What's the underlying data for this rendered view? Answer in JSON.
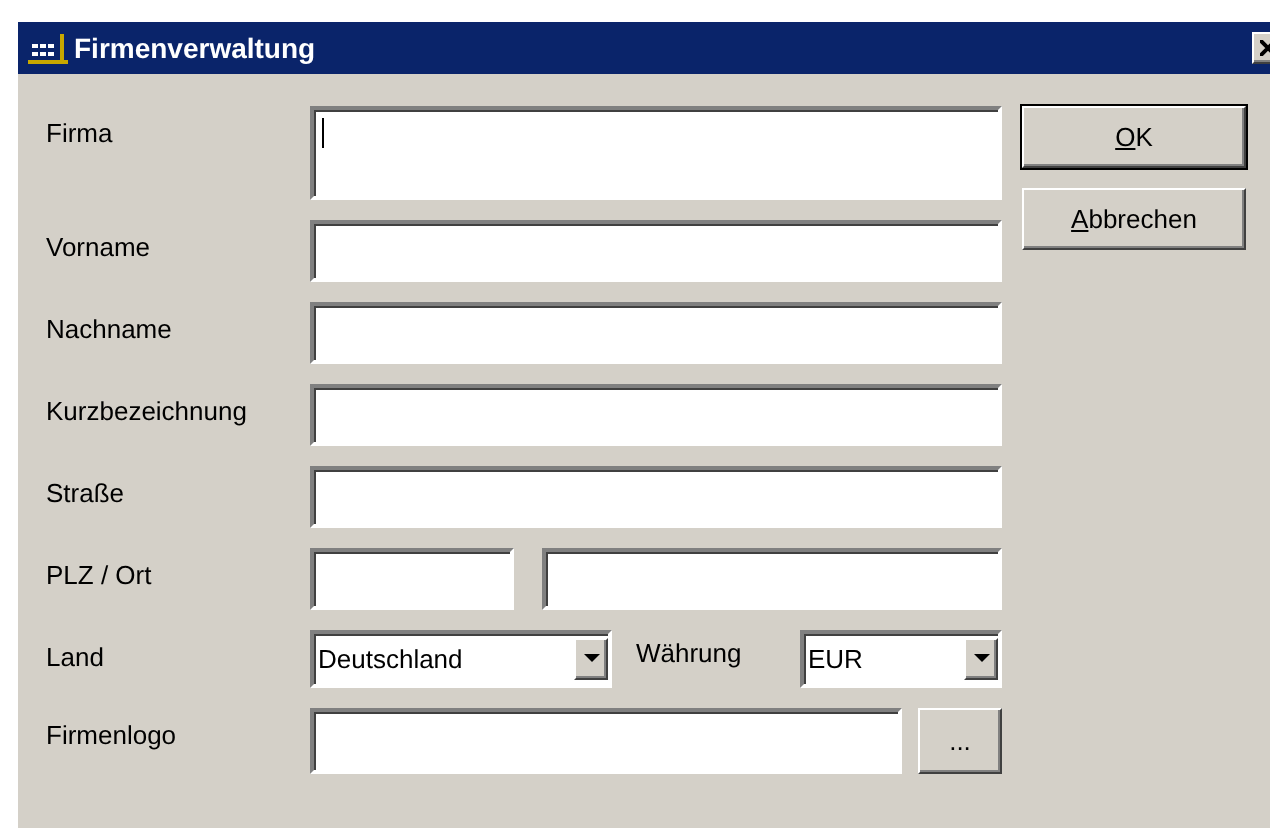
{
  "window": {
    "title": "Firmenverwaltung"
  },
  "fields": [
    {
      "kind": "multiline",
      "label": "Firma",
      "focused": true
    },
    {
      "kind": "text",
      "label": "Vorname"
    },
    {
      "kind": "text",
      "label": "Nachname"
    },
    {
      "kind": "text",
      "label": "Kurzbezeichnung"
    },
    {
      "kind": "text",
      "label": "Straße"
    },
    {
      "kind": "split",
      "label": "PLZ / Ort"
    },
    {
      "kind": "combo",
      "label": "Land",
      "value": "Deutschland",
      "label2": "Währung",
      "value2": "EUR"
    },
    {
      "kind": "file",
      "label": "Firmenlogo",
      "browse": "..."
    }
  ],
  "buttons": [
    {
      "label": "OK"
    },
    {
      "label": "Abbrechen"
    }
  ]
}
